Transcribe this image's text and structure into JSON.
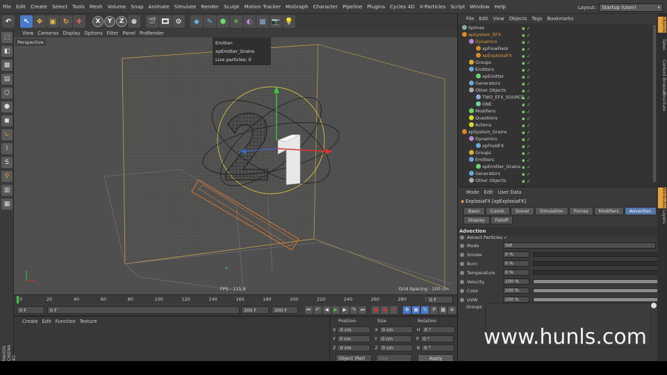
{
  "menubar": {
    "items": [
      "File",
      "Edit",
      "Create",
      "Select",
      "Tools",
      "Mesh",
      "Volume",
      "Snap",
      "Animate",
      "Simulate",
      "Render",
      "Sculpt",
      "Motion Tracker",
      "MoGraph",
      "Character",
      "Pipeline",
      "Plugins",
      "Cycles 4D",
      "X-Particles",
      "Script",
      "Window",
      "Help"
    ],
    "layout_label": "Layout:",
    "layout_value": "Startup (User)"
  },
  "toolbar": {
    "axes": [
      "X",
      "Y",
      "Z"
    ]
  },
  "viewport": {
    "menu": [
      "View",
      "Cameras",
      "Display",
      "Options",
      "Filter",
      "Panel",
      "ProRender"
    ],
    "label": "Perspective",
    "tooltip_line1": "Emitter: xpEmitter_Grains",
    "tooltip_line2": "Live particles: 0",
    "fps": "FPS : 115.9",
    "grid_spacing": "Grid Spacing : 100 cm"
  },
  "timeline": {
    "ticks": [
      "0",
      "20",
      "40",
      "60",
      "80",
      "100",
      "120",
      "140",
      "160",
      "180",
      "200",
      "220",
      "240",
      "260",
      "280",
      "300"
    ],
    "end_frame": "0 F"
  },
  "transport": {
    "start": "0 F",
    "current": "0 F",
    "max": "300 F",
    "end": "300 F"
  },
  "material": {
    "menu": [
      "Create",
      "Edit",
      "Function",
      "Texture"
    ]
  },
  "coords": {
    "headers": [
      "Position",
      "Size",
      "Rotation"
    ],
    "rows": [
      {
        "axis": "X",
        "pos": "0 cm",
        "saxis": "X",
        "size": "0 cm",
        "raxis": "H",
        "rot": "0 °"
      },
      {
        "axis": "Y",
        "pos": "0 cm",
        "saxis": "Y",
        "size": "0 cm",
        "raxis": "P",
        "rot": "0 °"
      },
      {
        "axis": "Z",
        "pos": "0 cm",
        "saxis": "Z",
        "size": "0 cm",
        "raxis": "B",
        "rot": "0 °"
      }
    ],
    "mode": "Object (Rel)",
    "size_mode": "Size",
    "apply": "Apply"
  },
  "objects": {
    "menu": [
      "File",
      "Edit",
      "View",
      "Objects",
      "Tags",
      "Bookmarks"
    ],
    "rows": [
      {
        "label": "Splines",
        "indent": 0,
        "color": "#8aa"
      },
      {
        "label": "xpSystem_EFX",
        "indent": 0,
        "color": "#d98a2b",
        "hl": true
      },
      {
        "label": "Dynamics",
        "indent": 1,
        "color": "#b68ad8",
        "hl": true
      },
      {
        "label": "xpFlowField",
        "indent": 2,
        "color": "#d98a2b"
      },
      {
        "label": "xpExplosiaFX",
        "indent": 2,
        "color": "#d98a2b",
        "hl": true
      },
      {
        "label": "Groups",
        "indent": 1,
        "color": "#d9b02b"
      },
      {
        "label": "Emitters",
        "indent": 1,
        "color": "#6aa7d8"
      },
      {
        "label": "xpEmitter",
        "indent": 2,
        "color": "#6ad86a"
      },
      {
        "label": "Generators",
        "indent": 1,
        "color": "#6aa7d8"
      },
      {
        "label": "Other Objects",
        "indent": 1,
        "color": "#aaaaaa"
      },
      {
        "label": "TWO_EFX_SOURCE",
        "indent": 2,
        "color": "#8ab0d8"
      },
      {
        "label": "ONE",
        "indent": 2,
        "color": "#6ad8a8"
      },
      {
        "label": "Modifiers",
        "indent": 1,
        "color": "#6ad86a"
      },
      {
        "label": "Questions",
        "indent": 1,
        "color": "#d9d92b"
      },
      {
        "label": "Actions",
        "indent": 1,
        "color": "#d9d92b"
      },
      {
        "label": "xpSystem_Grains",
        "indent": 0,
        "color": "#d98a2b"
      },
      {
        "label": "Dynamics",
        "indent": 1,
        "color": "#b68ad8"
      },
      {
        "label": "xpFluidFX",
        "indent": 2,
        "color": "#6aa7d8"
      },
      {
        "label": "Groups",
        "indent": 1,
        "color": "#d9b02b"
      },
      {
        "label": "Emitters",
        "indent": 1,
        "color": "#6aa7d8"
      },
      {
        "label": "xpEmitter_Grains",
        "indent": 2,
        "color": "#6ad86a"
      },
      {
        "label": "Generators",
        "indent": 1,
        "color": "#6aa7d8"
      },
      {
        "label": "Other Objects",
        "indent": 1,
        "color": "#aaaaaa"
      }
    ]
  },
  "attributes": {
    "menu": [
      "Mode",
      "Edit",
      "User Data"
    ],
    "title": "ExplosiaFX [xpExplosiaFX]",
    "tabs_row1": [
      "Basic",
      "Coord.",
      "Solver",
      "Simulation",
      "Forces",
      "Modifiers",
      "Advection"
    ],
    "tabs_row2": [
      "Display",
      "Falloff"
    ],
    "active_tab": "Advection",
    "section": "Advection",
    "advect_label": "Advect Particles",
    "advect_check": "✓",
    "mode_label": "Mode",
    "mode_value": "Set",
    "params": [
      {
        "label": "Smoke",
        "value": "0 %",
        "fill": 0.0
      },
      {
        "label": "Burn",
        "value": "0 %",
        "fill": 0.0
      },
      {
        "label": "Temperature",
        "value": "0 %",
        "fill": 0.0
      },
      {
        "label": "Velocity",
        "value": "100 %",
        "fill": 1.0
      },
      {
        "label": "Color",
        "value": "100 %",
        "fill": 1.0
      },
      {
        "label": "UVW",
        "value": "100 %",
        "fill": 1.0
      }
    ],
    "groups_label": "Groups"
  },
  "side_tabs": [
    "Objects",
    "Takes",
    "Content Browser",
    "Structure",
    "Attributes",
    "Layers"
  ],
  "branding": {
    "app": "MAXON CINEMA 4D",
    "watermark": "www.hunls.com"
  }
}
